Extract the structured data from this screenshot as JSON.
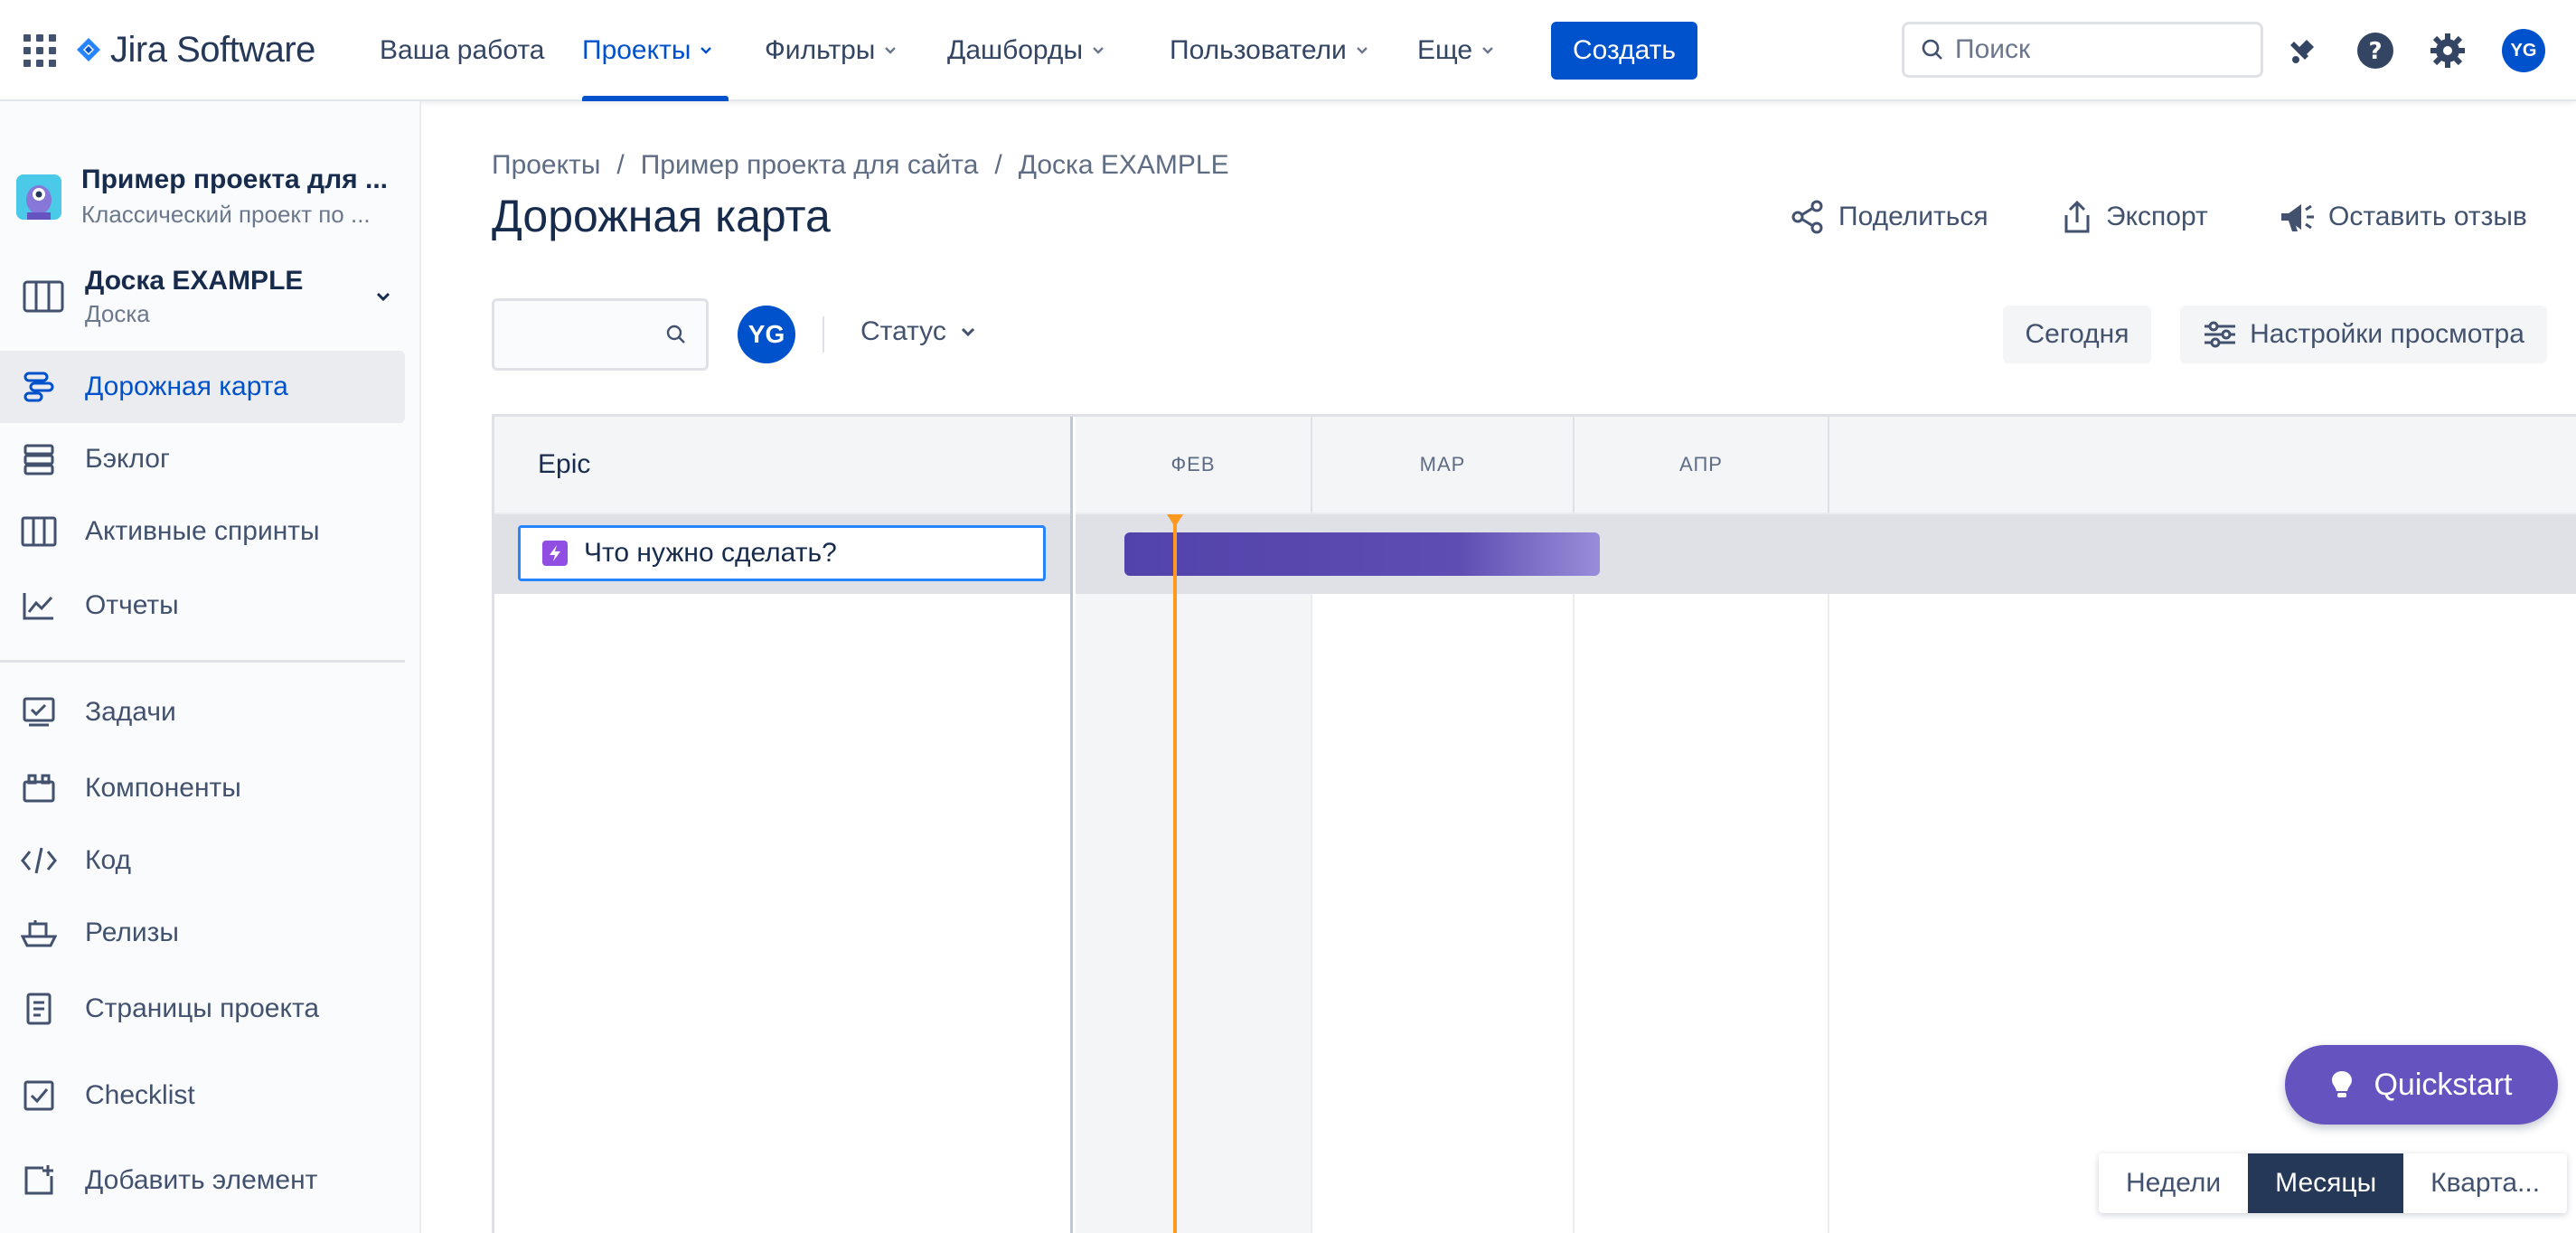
{
  "topnav": {
    "logo_text": "Jira Software",
    "items": [
      {
        "label": "Ваша работа"
      },
      {
        "label": "Проекты"
      },
      {
        "label": "Фильтры"
      },
      {
        "label": "Дашборды"
      },
      {
        "label": "Пользователи"
      },
      {
        "label": "Еще"
      }
    ],
    "create_label": "Создать",
    "search_placeholder": "Поиск",
    "user_initials": "YG",
    "accent": "#0052cc"
  },
  "sidebar": {
    "project_name": "Пример проекта для ...",
    "project_sub": "Классический проект по ...",
    "board_name": "Доска EXAMPLE",
    "board_sub": "Доска",
    "items": [
      {
        "label": "Дорожная карта",
        "icon": "roadmap-icon"
      },
      {
        "label": "Бэклог",
        "icon": "backlog-icon"
      },
      {
        "label": "Активные спринты",
        "icon": "board-icon"
      },
      {
        "label": "Отчеты",
        "icon": "reports-icon"
      },
      {
        "label": "Задачи",
        "icon": "issues-icon"
      },
      {
        "label": "Компоненты",
        "icon": "components-icon"
      },
      {
        "label": "Код",
        "icon": "code-icon"
      },
      {
        "label": "Релизы",
        "icon": "releases-icon"
      },
      {
        "label": "Страницы проекта",
        "icon": "pages-icon"
      },
      {
        "label": "Checklist",
        "icon": "checklist-icon"
      },
      {
        "label": "Добавить элемент",
        "icon": "add-item-icon"
      }
    ]
  },
  "breadcrumb": {
    "items": [
      "Проекты",
      "Пример проекта для сайта",
      "Доска EXAMPLE"
    ],
    "separator": "/"
  },
  "page_title": "Дорожная карта",
  "actions": {
    "share": "Поделиться",
    "export": "Экспорт",
    "feedback": "Оставить отзыв"
  },
  "filters": {
    "avatar": "YG",
    "status": "Статус",
    "today": "Сегодня",
    "view_settings": "Настройки просмотра"
  },
  "roadmap": {
    "epic_header": "Epic",
    "months": [
      "ФЕВ",
      "МАР",
      "АПР"
    ],
    "new_epic_placeholder": "Что нужно сделать?",
    "bar_color": "#5243aa",
    "today_color": "#ff991f"
  },
  "quickstart_label": "Quickstart",
  "zoom": {
    "weeks": "Недели",
    "months": "Месяцы",
    "quarters": "Кварта..."
  }
}
